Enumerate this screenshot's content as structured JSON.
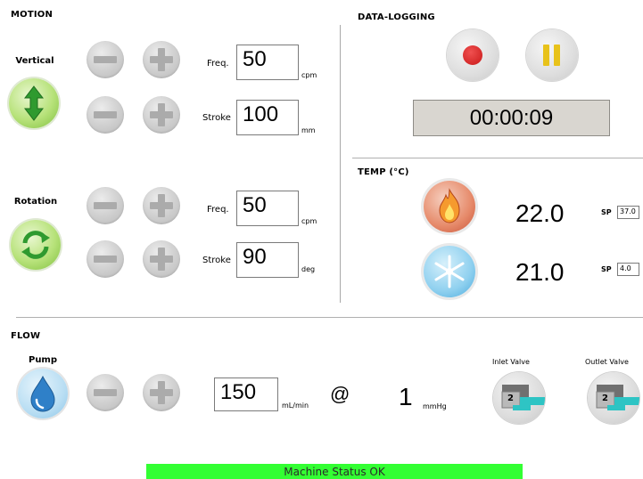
{
  "motion": {
    "title": "MOTION",
    "vertical": {
      "label": "Vertical",
      "freq_label": "Freq.",
      "freq_value": "50",
      "freq_unit": "cpm",
      "stroke_label": "Stroke",
      "stroke_value": "100",
      "stroke_unit": "mm"
    },
    "rotation": {
      "label": "Rotation",
      "freq_label": "Freq.",
      "freq_value": "50",
      "freq_unit": "cpm",
      "stroke_label": "Stroke",
      "stroke_value": "90",
      "stroke_unit": "deg"
    }
  },
  "logging": {
    "title": "DATA-LOGGING",
    "timer": "00:00:09"
  },
  "temp": {
    "title": "TEMP (°C)",
    "heater_value": "22.0",
    "heater_sp_label": "SP",
    "heater_sp": "37.0",
    "cooler_value": "21.0",
    "cooler_sp_label": "SP",
    "cooler_sp": "4.0"
  },
  "flow": {
    "title": "FLOW",
    "pump_label": "Pump",
    "flow_value": "150",
    "flow_unit": "mL/min",
    "at_symbol": "@",
    "pressure_value": "1",
    "pressure_unit": "mmHg",
    "inlet_label": "Inlet Valve",
    "inlet_state": "2",
    "outlet_label": "Outlet Valve",
    "outlet_state": "2"
  },
  "status": {
    "text": "Machine Status OK",
    "color": "#33ff33"
  },
  "colors": {
    "record": "#cc1f1f",
    "pause": "#e8c21a",
    "valve_accent": "#2ec4c4",
    "arrow_green": "#2f9a2f",
    "flame": "#e87a2c",
    "snow": "#56b8e8",
    "drop": "#2f80c8"
  }
}
